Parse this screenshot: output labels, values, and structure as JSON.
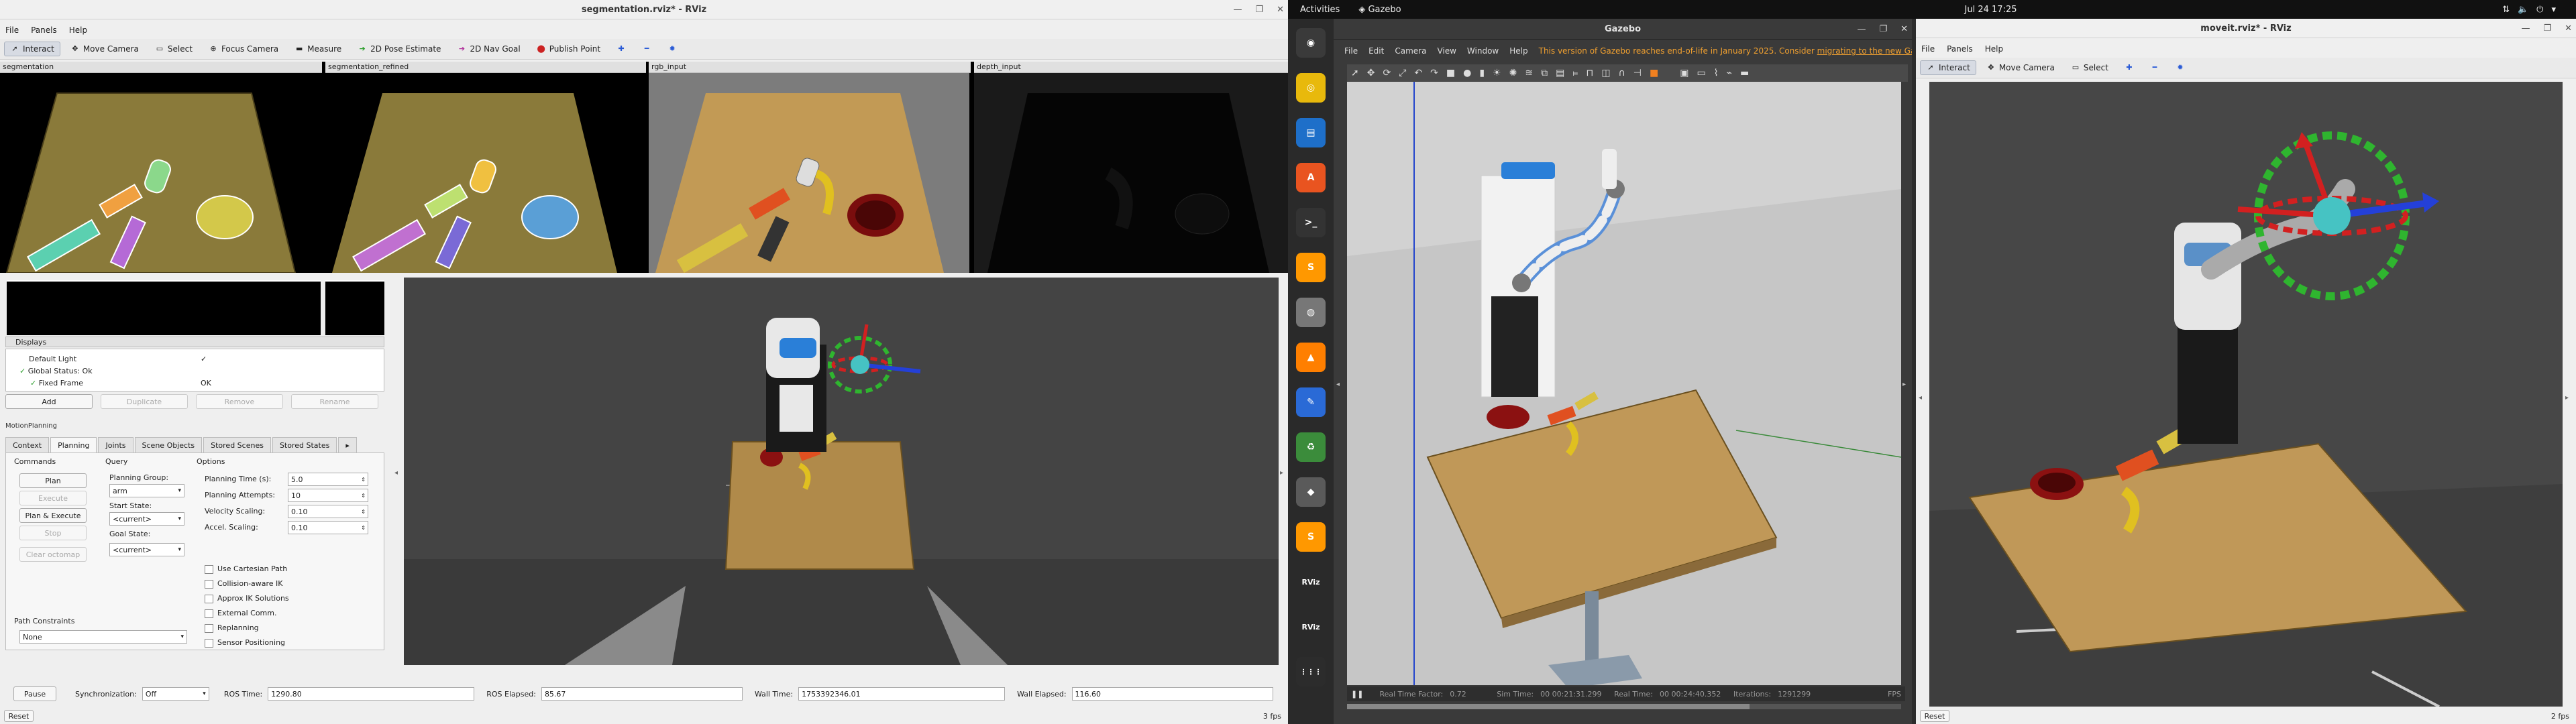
{
  "left_rviz": {
    "title": "segmentation.rviz* - RViz",
    "menu": [
      "File",
      "Panels",
      "Help"
    ],
    "toolbar": [
      {
        "label": "Interact",
        "icon": "interact-icon",
        "active": true
      },
      {
        "label": "Move Camera",
        "icon": "move-camera-icon"
      },
      {
        "label": "Select",
        "icon": "select-icon"
      },
      {
        "label": "Focus Camera",
        "icon": "focus-camera-icon"
      },
      {
        "label": "Measure",
        "icon": "measure-icon"
      },
      {
        "label": "2D Pose Estimate",
        "icon": "pose-estimate-icon"
      },
      {
        "label": "2D Nav Goal",
        "icon": "nav-goal-icon"
      },
      {
        "label": "Publish Point",
        "icon": "publish-point-icon"
      }
    ],
    "image_panels": [
      "segmentation",
      "segmentation_refined",
      "rgb_input",
      "depth_input"
    ],
    "displays": {
      "title": "Displays",
      "rows": [
        {
          "name": "Default Light",
          "value": "✓"
        },
        {
          "name": "Global Status: Ok",
          "value": ""
        },
        {
          "name": "Fixed Frame",
          "value": "OK"
        }
      ],
      "buttons": [
        "Add",
        "Duplicate",
        "Remove",
        "Rename"
      ]
    },
    "motion_planning": {
      "header": "MotionPlanning",
      "tabs": [
        "Context",
        "Planning",
        "Joints",
        "Scene Objects",
        "Stored Scenes",
        "Stored States"
      ],
      "active_tab": "Planning",
      "commands": {
        "title": "Commands",
        "buttons": [
          {
            "label": "Plan",
            "enabled": true
          },
          {
            "label": "Execute",
            "enabled": false
          },
          {
            "label": "Plan & Execute",
            "enabled": true
          },
          {
            "label": "Stop",
            "enabled": false
          },
          {
            "label": "Clear octomap",
            "enabled": false
          }
        ]
      },
      "query": {
        "title": "Query",
        "planning_group_label": "Planning Group:",
        "planning_group": "arm",
        "start_state_label": "Start State:",
        "start_state": "<current>",
        "goal_state_label": "Goal State:",
        "goal_state": "<current>"
      },
      "options": {
        "title": "Options",
        "fields": [
          {
            "label": "Planning Time (s):",
            "value": "5.0"
          },
          {
            "label": "Planning Attempts:",
            "value": "10"
          },
          {
            "label": "Velocity Scaling:",
            "value": "0.10"
          },
          {
            "label": "Accel. Scaling:",
            "value": "0.10"
          }
        ],
        "checkboxes": [
          "Use Cartesian Path",
          "Collision-aware IK",
          "Approx IK Solutions",
          "External Comm.",
          "Replanning",
          "Sensor Positioning"
        ]
      },
      "path_constraints": {
        "label": "Path Constraints",
        "value": "None"
      }
    },
    "time_bar": {
      "pause": "Pause",
      "sync_label": "Synchronization:",
      "sync_value": "Off",
      "ros_time_label": "ROS Time:",
      "ros_time": "1290.80",
      "ros_elapsed_label": "ROS Elapsed:",
      "ros_elapsed": "85.67",
      "wall_time_label": "Wall Time:",
      "wall_time": "1753392346.01",
      "wall_elapsed_label": "Wall Elapsed:",
      "wall_elapsed": "116.60"
    },
    "reset": "Reset",
    "fps": "3 fps"
  },
  "topbar": {
    "activities": "Activities",
    "app": "Gazebo",
    "datetime": "Jul 24  17:25"
  },
  "dock": [
    {
      "name": "chrome-icon",
      "glyph": "◉",
      "color": "#3a3a3a"
    },
    {
      "name": "rhythmbox-icon",
      "glyph": "◎",
      "color": "#e8b90c"
    },
    {
      "name": "writer-icon",
      "glyph": "▤",
      "color": "#1e6fc9"
    },
    {
      "name": "software-icon",
      "glyph": "A",
      "color": "#e95420"
    },
    {
      "name": "terminal-icon",
      "glyph": ">_",
      "color": "#333333"
    },
    {
      "name": "sublime-icon",
      "glyph": "S",
      "color": "#ff9800"
    },
    {
      "name": "disk-icon",
      "glyph": "◍",
      "color": "#777777"
    },
    {
      "name": "vlc-icon",
      "glyph": "▲",
      "color": "#ff7f00"
    },
    {
      "name": "editor-icon",
      "glyph": "✎",
      "color": "#2a6ad6"
    },
    {
      "name": "trash-icon",
      "glyph": "♻",
      "color": "#3b8c3b"
    },
    {
      "name": "gazebo-icon",
      "glyph": "◆",
      "color": "#5a5a5a"
    },
    {
      "name": "sublime-icon-2",
      "glyph": "S",
      "color": "#ff9800"
    },
    {
      "name": "rviz-icon",
      "glyph": "RViz",
      "color": "#2a2a2a"
    },
    {
      "name": "rviz-icon-2",
      "glyph": "RViz",
      "color": "#2a2a2a"
    },
    {
      "name": "apps-grid-icon",
      "glyph": "⋮⋮⋮",
      "color": "#2c2c2c"
    }
  ],
  "gazebo": {
    "title": "Gazebo",
    "menu": [
      "File",
      "Edit",
      "Camera",
      "View",
      "Window",
      "Help"
    ],
    "notice": "This version of Gazebo reaches end-of-life in January 2025. Consider",
    "notice_link": "migrating to the new Gazebo",
    "status": {
      "rtf_label": "Real Time Factor:",
      "rtf": "0.72",
      "sim_label": "Sim Time:",
      "sim": "00 00:21:31.299",
      "real_label": "Real Time:",
      "real": "00 00:24:40.352",
      "iter_label": "Iterations:",
      "iter": "1291299",
      "fps": "FPS"
    }
  },
  "right_rviz": {
    "title": "moveit.rviz* - RViz",
    "menu": [
      "File",
      "Panels",
      "Help"
    ],
    "toolbar": [
      {
        "label": "Interact",
        "icon": "interact-icon",
        "active": true
      },
      {
        "label": "Move Camera",
        "icon": "move-camera-icon"
      },
      {
        "label": "Select",
        "icon": "select-icon"
      }
    ],
    "reset": "Reset",
    "fps": "2 fps"
  },
  "colors": {
    "table": "#b08a4a",
    "bowl": "#8b1111",
    "grid_bg": "#3c3c3c",
    "ring_green": "#2fb52f",
    "arrow_red": "#d22020",
    "arrow_blue": "#2440d8"
  }
}
